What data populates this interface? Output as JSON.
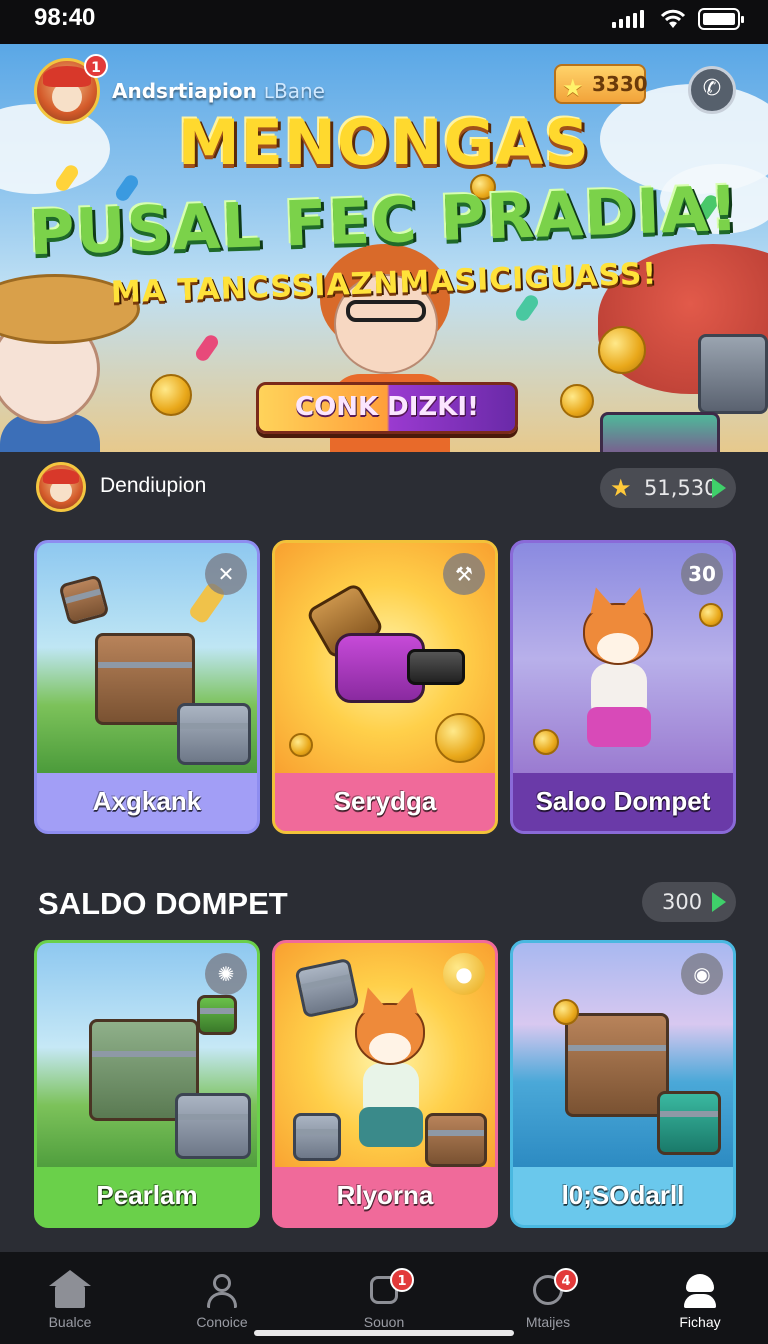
{
  "status_bar": {
    "time": "98:40"
  },
  "hero": {
    "user_name": "Andsrtiapion",
    "user_sub": "ʟBane",
    "avatar_badge": "1",
    "coins": "3330",
    "title_line1": "MENONGAS",
    "title_line2": "PUSAL FEC PRADIA!",
    "title_line3": "MA TANCSSIAZNMASICIGUASS!",
    "cta_label": "CONK DIZKI!",
    "icons": {
      "coins": "star-icon",
      "action": "phone-icon"
    }
  },
  "section1": {
    "label": "Dendiupion",
    "balance": "51,530",
    "cards": [
      {
        "label": "Axgkank",
        "corner": "✕",
        "color": "#8e8df0"
      },
      {
        "label": "Serydga",
        "corner": "⚒",
        "color": "#f06a9a"
      },
      {
        "label": "Saloo Dompet",
        "corner": "30",
        "color": "#6a3aa8"
      }
    ]
  },
  "section2": {
    "title": "SALDO DOMPET",
    "count": "300",
    "cards": [
      {
        "label": "Pearlam",
        "corner": "✺",
        "color": "#6ad04a"
      },
      {
        "label": "Rlyorna",
        "corner": "●",
        "color": "#f06a9a"
      },
      {
        "label": "l0;SOdarll",
        "corner": "◉",
        "color": "#4ab8e0"
      }
    ]
  },
  "nav": {
    "items": [
      {
        "label": "Bualce",
        "icon": "home-icon",
        "badge": ""
      },
      {
        "label": "Conoice",
        "icon": "user-icon",
        "badge": ""
      },
      {
        "label": "Souon",
        "icon": "tasks-icon",
        "badge": "1"
      },
      {
        "label": "Mtaijes",
        "icon": "ball-icon",
        "badge": "4"
      },
      {
        "label": "Fichay",
        "icon": "chef-icon",
        "badge": ""
      }
    ],
    "active_index": 4
  }
}
